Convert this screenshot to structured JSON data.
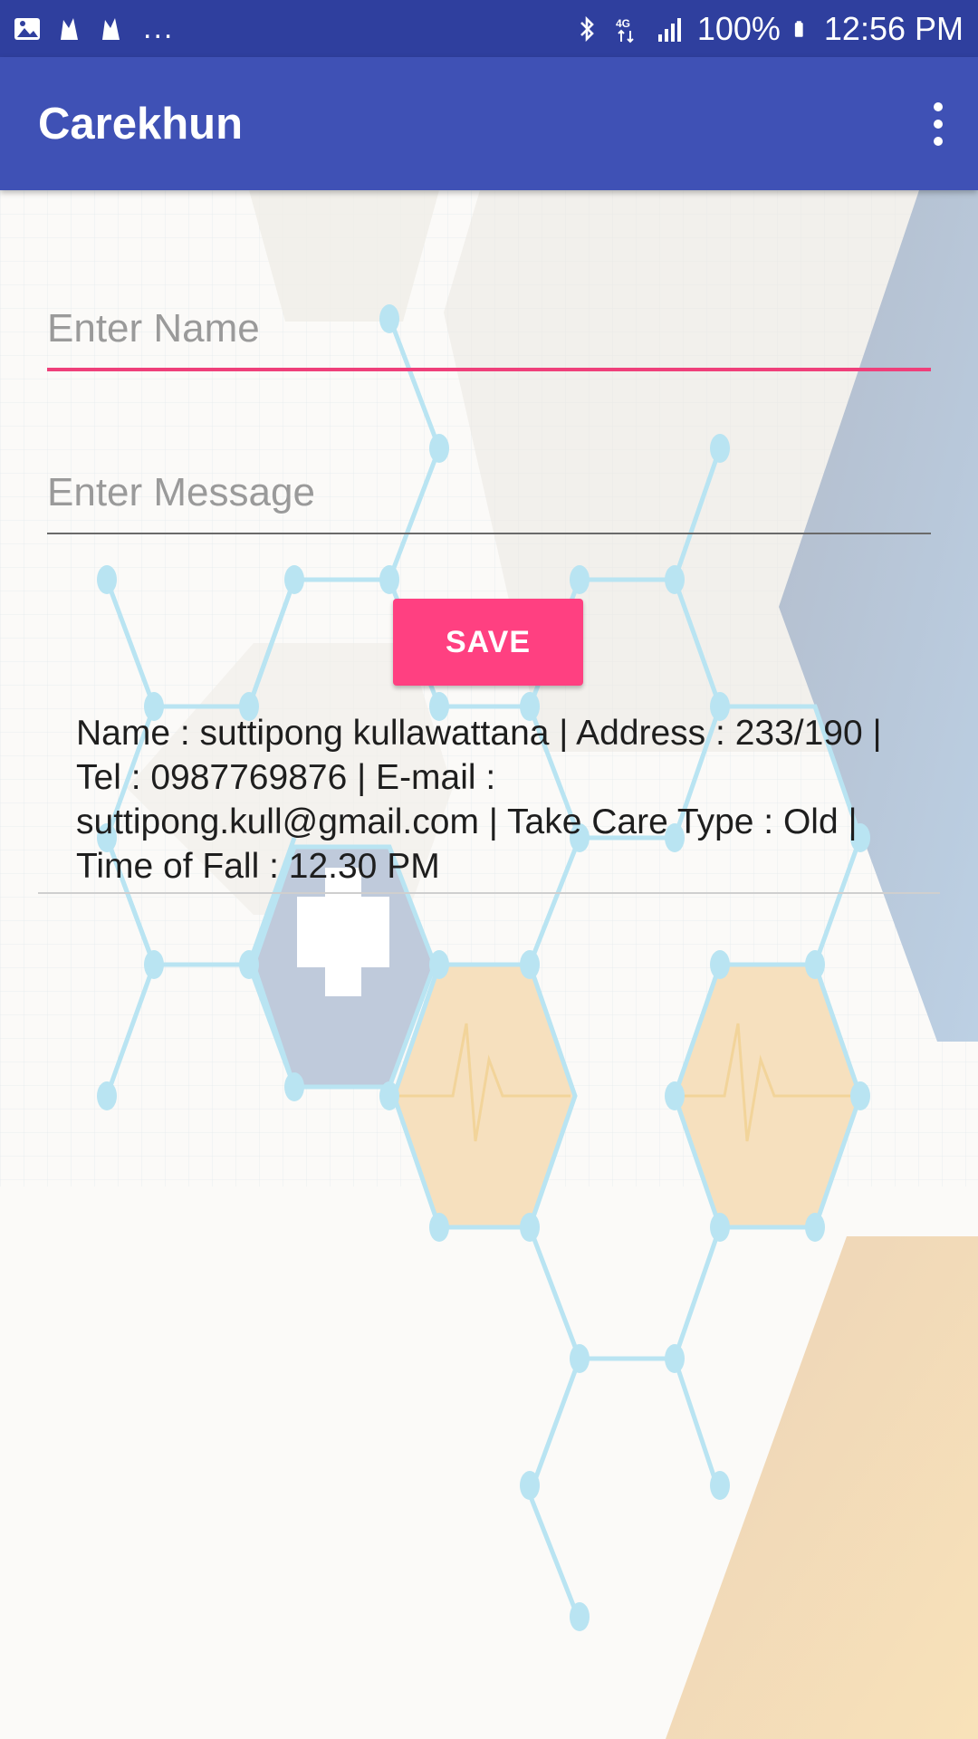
{
  "status_bar": {
    "left_icons": [
      "image-icon",
      "flame-icon",
      "flame-icon"
    ],
    "more": "...",
    "battery": "100%",
    "time": "12:56 PM"
  },
  "app_bar": {
    "title": "Carekhun",
    "menu_icon": "more-vert-icon"
  },
  "form": {
    "name_placeholder": "Enter Name",
    "name_value": "",
    "message_placeholder": "Enter Message",
    "message_value": "",
    "save_label": "SAVE"
  },
  "records": [
    {
      "text": "Name : suttipong kullawattana | Address : 233/190 | Tel : 0987769876 | E-mail : suttipong.kull@gmail.com | Take Care Type : Old | Time of Fall : 12.30 PM"
    }
  ],
  "colors": {
    "status_bar": "#2f3f9e",
    "app_bar": "#3f51b5",
    "accent": "#ff4081",
    "background": "#fbfaf8"
  }
}
